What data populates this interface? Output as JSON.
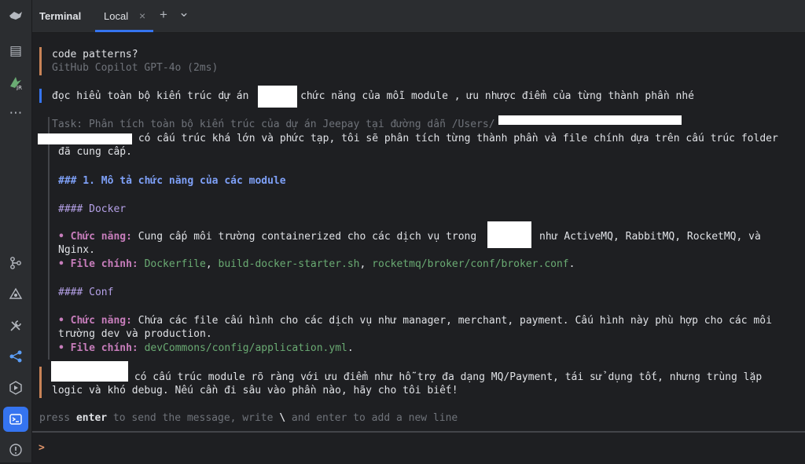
{
  "header": {
    "title": "Terminal",
    "tab_label": "Local",
    "close_glyph": "×",
    "add_glyph": "+",
    "dropdown_glyph": "⌄"
  },
  "sidebar": {
    "icons": [
      "structure-icon",
      "jrebel-icon",
      "more-icon",
      "git-icon",
      "graph-icon",
      "build-icon",
      "services-icon",
      "run-icon",
      "terminal-icon",
      "problems-icon"
    ],
    "glyphs": [
      "▤",
      "🚀",
      "⋯",
      "⌥",
      "⬡",
      "✂",
      "⋰",
      "▷",
      "▣",
      "ⓘ"
    ]
  },
  "chat": {
    "q1_text": "code patterns?",
    "q1_meta": "GitHub Copilot GPT-4o (2ms)",
    "user_message_a": "đọc hiểu toàn bộ kiến trúc dự án",
    "user_message_b": ", chức năng của mỗi module , ưu nhược điểm của từng thành phần nhé",
    "task_line": "Task: Phân tích toàn bộ kiến trúc của dự án Jeepay tại đường dẫn /Users/",
    "resp_line1": " có cấu trúc khá lớn và phức tạp, tôi sẽ phân tích từng thành phần và file chính dựa trên cấu trúc folder",
    "resp_line2": "đã cung cấp.",
    "heading1": "### 1. Mô tả chức năng của các module",
    "heading_docker": "#### Docker",
    "docker_func_key": "• Chức năng:",
    "docker_func_a": " Cung cấp môi trường containerized cho các dịch vụ trong",
    "docker_func_b": " như ActiveMQ, RabbitMQ, RocketMQ, và",
    "docker_func_c": "Nginx.",
    "docker_file_key": "• File chính:",
    "docker_file_1": " Dockerfile",
    "docker_file_sep1": ", ",
    "docker_file_2": "build-docker-starter.sh",
    "docker_file_sep2": ", ",
    "docker_file_3": "rocketmq/broker/conf/broker.conf",
    "docker_file_end": ".",
    "heading_conf": "#### Conf",
    "conf_func_key": "• Chức năng:",
    "conf_func_a": " Chứa các file cấu hình cho các dịch vụ như manager, merchant, payment. Cấu hình này phù hợp cho các môi",
    "conf_func_b": "trường dev và production.",
    "conf_file_key": "• File chính:",
    "conf_file_1": " devCommons/config/application.yml",
    "conf_file_end": ".",
    "summary_a": " có cấu trúc module rõ ràng với ưu điểm như hỗ trợ đa dạng MQ/Payment, tái sử dụng tốt, nhưng trùng lặp",
    "summary_b": "logic và khó debug. Nếu cần đi sâu vào phần nào, hãy cho tôi biết!"
  },
  "hint": {
    "a": "press ",
    "enter": "enter",
    "b": " to send the message, write ",
    "slash": "\\",
    "c": " and enter to add a new line"
  },
  "input": {
    "prompt": ">"
  }
}
